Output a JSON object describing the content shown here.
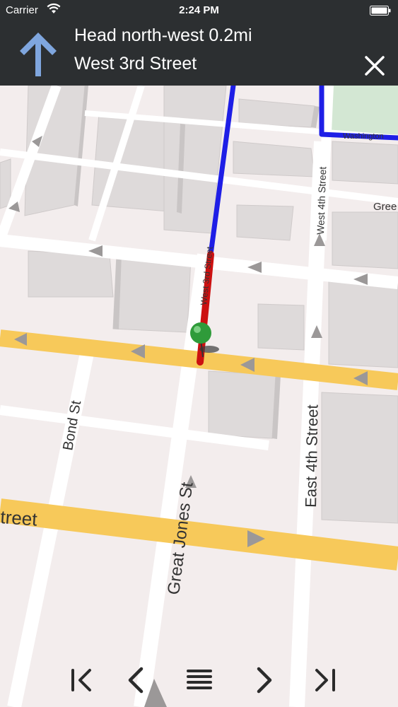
{
  "status_bar": {
    "carrier": "Carrier",
    "time": "2:24 PM",
    "wifi_icon": "wifi-icon",
    "battery_icon": "battery-icon"
  },
  "navigation": {
    "maneuver_icon": "arrow-up-icon",
    "instruction": "Head north-west 0.2mi",
    "street": "West 3rd Street",
    "close_icon": "close-icon"
  },
  "map": {
    "labels": {
      "west_4th_street": "West 4th Street",
      "west_3rd_street": "West 3rd Street",
      "greene": "Gree",
      "bond_st": "Bond St",
      "great_jones_st": "Great Jones St",
      "east_4th_street": "East 4th Street",
      "street_fragment": "treet",
      "washington_fragment": "Washington"
    },
    "colors": {
      "route_upcoming": "#1e1ee6",
      "route_current": "#cc1111",
      "major_road": "#f7c95a",
      "minor_road": "#ffffff",
      "park": "#d3e7d3",
      "building": "#dcd9d9",
      "ground": "#f3eded",
      "location_marker": "#2f9b3a"
    }
  },
  "controls": {
    "first_icon": "skip-to-start-icon",
    "previous_icon": "chevron-left-icon",
    "list_icon": "list-icon",
    "next_icon": "chevron-right-icon",
    "last_icon": "skip-to-end-icon"
  }
}
